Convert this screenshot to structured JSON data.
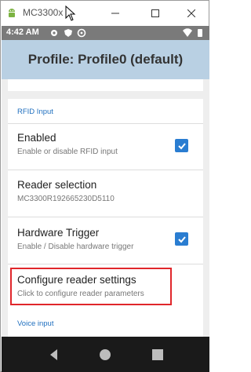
{
  "window": {
    "title": "MC3300x"
  },
  "statusbar": {
    "time": "4:42 AM"
  },
  "appbar": {
    "title": "Profile: Profile0 (default)"
  },
  "partial_item_text": "parameters",
  "rfid_section": {
    "header": "RFID Input",
    "items": [
      {
        "title": "Enabled",
        "summary": "Enable or disable RFID input",
        "checked": true
      },
      {
        "title": "Reader selection",
        "summary": "MC3300R192665230D5110"
      },
      {
        "title": "Hardware Trigger",
        "summary": "Enable / Disable hardware trigger",
        "checked": true
      },
      {
        "title": "Configure reader settings",
        "summary": "Click to configure reader parameters"
      }
    ]
  },
  "voice_section": {
    "header": "Voice input"
  },
  "colors": {
    "accent": "#2a7dd1",
    "appbar": "#b9d0e3",
    "highlight": "#e0262b",
    "statusbar": "#7a7a7a"
  }
}
